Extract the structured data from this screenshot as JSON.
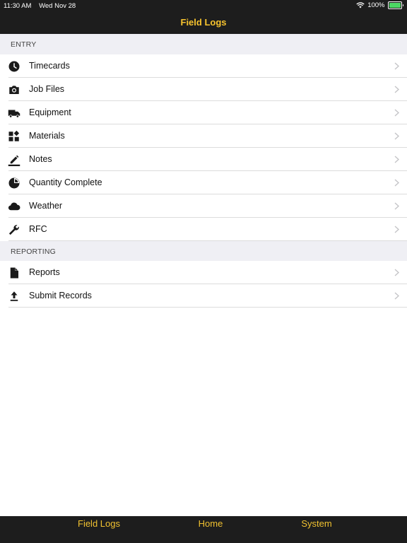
{
  "status_bar": {
    "time": "11:30 AM",
    "date": "Wed Nov 28",
    "battery": "100%"
  },
  "nav": {
    "title": "Field Logs"
  },
  "sections": {
    "entry": {
      "header": "ENTRY",
      "items": [
        {
          "label": "Timecards",
          "icon": "clock-icon"
        },
        {
          "label": "Job Files",
          "icon": "camera-icon"
        },
        {
          "label": "Equipment",
          "icon": "truck-icon"
        },
        {
          "label": "Materials",
          "icon": "widgets-icon"
        },
        {
          "label": "Notes",
          "icon": "pencil-icon"
        },
        {
          "label": "Quantity Complete",
          "icon": "pie-chart-icon"
        },
        {
          "label": "Weather",
          "icon": "cloud-icon"
        },
        {
          "label": "RFC",
          "icon": "wrench-icon"
        }
      ]
    },
    "reporting": {
      "header": "REPORTING",
      "items": [
        {
          "label": "Reports",
          "icon": "document-icon"
        },
        {
          "label": "Submit Records",
          "icon": "upload-icon"
        }
      ]
    }
  },
  "tab_bar": {
    "tabs": [
      "Field Logs",
      "Home",
      "System"
    ]
  },
  "colors": {
    "accent": "#f7c32e",
    "bar_background": "#1d1d1d",
    "section_background": "#efeff4"
  }
}
